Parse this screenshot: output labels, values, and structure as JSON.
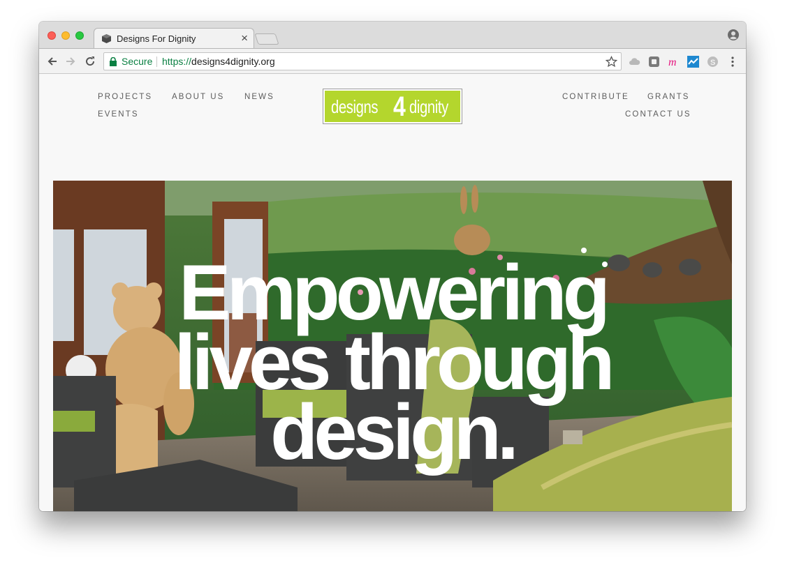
{
  "browser": {
    "tab_title": "Designs For Dignity",
    "tab_close": "×",
    "omnibox": {
      "secure_label": "Secure",
      "url_scheme": "https://",
      "url_host": "designs4dignity.org"
    },
    "icons": [
      "globe-favicon",
      "user-profile-icon",
      "back-arrow-icon",
      "forward-arrow-icon",
      "reload-icon",
      "lock-icon",
      "star-icon",
      "cloud-extension-icon",
      "square-extension-icon",
      "m-extension-icon",
      "blue-extension-icon",
      "skype-extension-icon",
      "kebab-menu-icon"
    ],
    "colors": {
      "secure_green": "#0b8043",
      "chrome_frame": "#dcdcdc"
    }
  },
  "site": {
    "nav_left": [
      "PROJECTS",
      "ABOUT US",
      "NEWS",
      "EVENTS"
    ],
    "nav_right": [
      "CONTRIBUTE",
      "GRANTS",
      "CONTACT US"
    ],
    "logo": {
      "word1": "designs",
      "digit": "4",
      "word2": "dignity",
      "color": "#b4d62d"
    },
    "hero": {
      "lines": [
        "Empowering",
        "lives through",
        "design."
      ]
    }
  }
}
